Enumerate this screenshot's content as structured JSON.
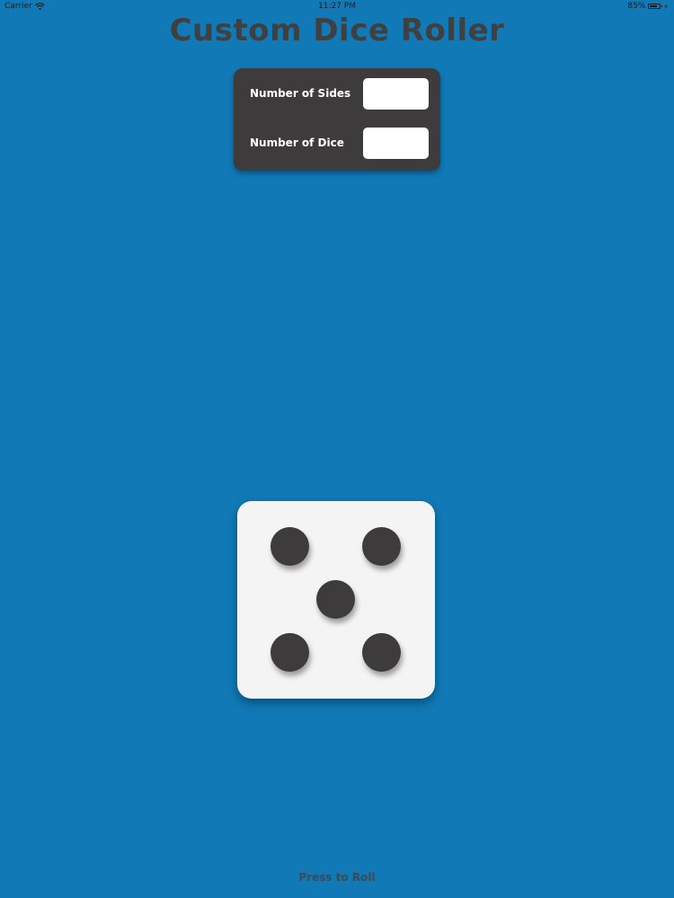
{
  "status_bar": {
    "carrier": "Carrier",
    "time": "11:27 PM",
    "battery": "85%"
  },
  "app": {
    "title": "Custom Dice Roller"
  },
  "settings": {
    "sides_label": "Number of Sides",
    "sides_value": "",
    "dice_label": "Number of Dice",
    "dice_value": ""
  },
  "die": {
    "face_value": 5
  },
  "roll_button": {
    "label": "Press to Roll"
  },
  "colors": {
    "background": "#1079b6",
    "panel": "#3e3b3c",
    "pip": "#3d3b3c",
    "die_face": "#f4f4f4",
    "title": "#404040"
  },
  "icons": [
    "wifi-icon",
    "battery-icon",
    "charging-icon"
  ]
}
